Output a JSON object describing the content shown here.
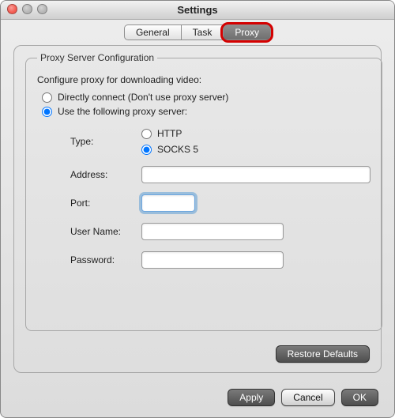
{
  "window": {
    "title": "Settings"
  },
  "tabs": {
    "general": "General",
    "task": "Task",
    "proxy": "Proxy",
    "active": "proxy"
  },
  "group": {
    "legend": "Proxy Server Configuration",
    "desc": "Configure proxy for downloading video:"
  },
  "mode": {
    "direct": "Directly connect (Don't use proxy server)",
    "use": "Use the following proxy server:",
    "selected": "use"
  },
  "fields": {
    "type_label": "Type:",
    "type_http": "HTTP",
    "type_socks5": "SOCKS 5",
    "type_selected": "socks5",
    "address_label": "Address:",
    "address_value": "",
    "port_label": "Port:",
    "port_value": "",
    "username_label": "User Name:",
    "username_value": "",
    "password_label": "Password:",
    "password_value": ""
  },
  "buttons": {
    "restore": "Restore Defaults",
    "apply": "Apply",
    "cancel": "Cancel",
    "ok": "OK"
  },
  "highlight": {
    "target": "proxy-tab"
  }
}
